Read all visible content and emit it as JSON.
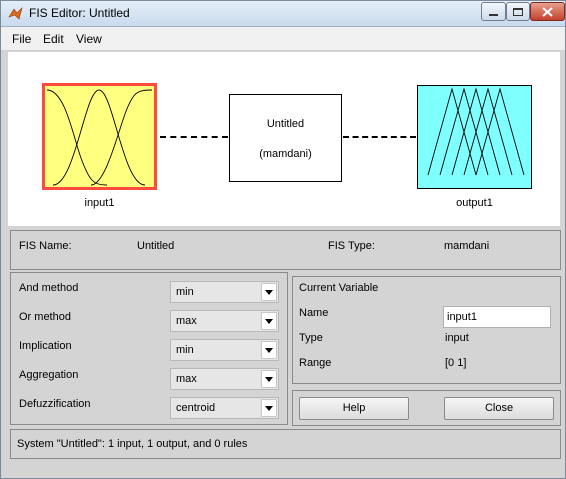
{
  "window": {
    "title": "FIS Editor: Untitled"
  },
  "menu": [
    "File",
    "Edit",
    "View"
  ],
  "diagram": {
    "input_label": "input1",
    "output_label": "output1",
    "fis_name": "Untitled",
    "fis_type": "(mamdani)",
    "colors": {
      "input_fill": "#ffff80",
      "input_border": "#ff4b3e",
      "output_fill": "#80ffff"
    }
  },
  "info": {
    "fis_name_label": "FIS Name:",
    "fis_name_value": "Untitled",
    "fis_type_label": "FIS Type:",
    "fis_type_value": "mamdani"
  },
  "methods": [
    {
      "label": "And method",
      "value": "min"
    },
    {
      "label": "Or method",
      "value": "max"
    },
    {
      "label": "Implication",
      "value": "min"
    },
    {
      "label": "Aggregation",
      "value": "max"
    },
    {
      "label": "Defuzzification",
      "value": "centroid"
    }
  ],
  "current_variable": {
    "heading": "Current Variable",
    "name_label": "Name",
    "name_value": "input1",
    "type_label": "Type",
    "type_value": "input",
    "range_label": "Range",
    "range_value": "[0 1]"
  },
  "buttons": {
    "help": "Help",
    "close": "Close"
  },
  "status": "System \"Untitled\": 1 input, 1 output, and 0 rules"
}
